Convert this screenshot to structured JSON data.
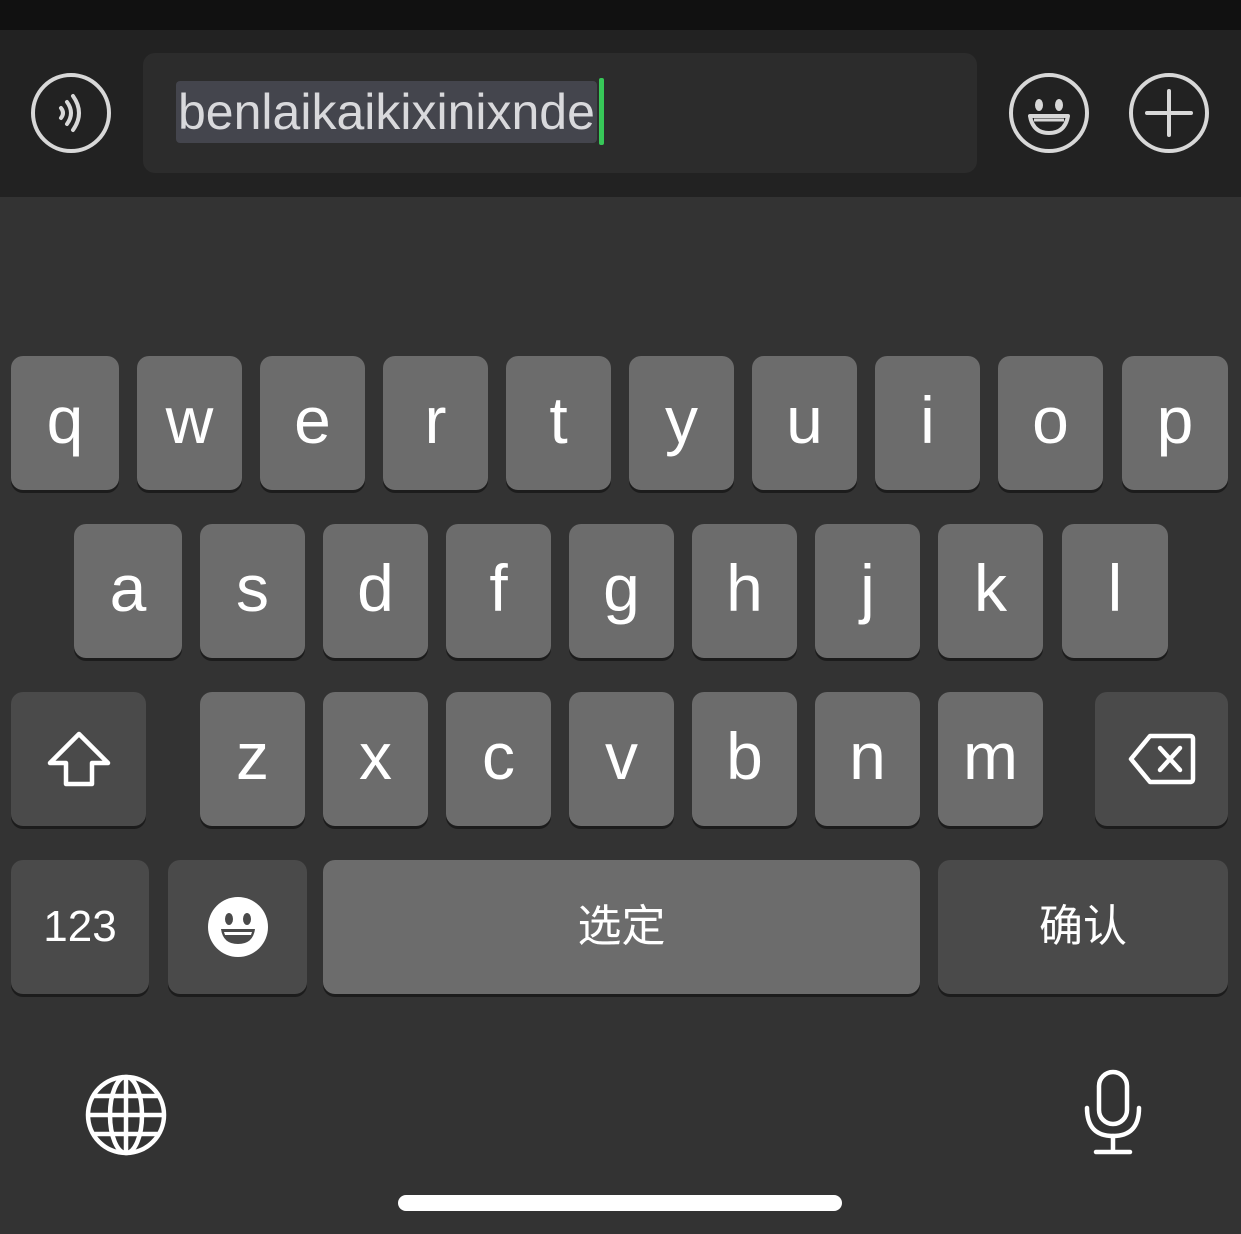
{
  "input_bar": {
    "typed_text": "benlaikaikixinixnde",
    "caret_color": "#37c758",
    "left_icon": "voice-message-icon",
    "right_icons": [
      "emoji-icon",
      "add-icon"
    ]
  },
  "keyboard": {
    "row1": [
      "q",
      "w",
      "e",
      "r",
      "t",
      "y",
      "u",
      "i",
      "o",
      "p"
    ],
    "row2": [
      "a",
      "s",
      "d",
      "f",
      "g",
      "h",
      "j",
      "k",
      "l"
    ],
    "row3": [
      "z",
      "x",
      "c",
      "v",
      "b",
      "n",
      "m"
    ],
    "shift_icon": "shift-icon",
    "delete_icon": "backspace-icon",
    "numbers_label": "123",
    "emoji_key_icon": "emoji-icon",
    "space_label": "选定",
    "confirm_label": "确认",
    "globe_icon": "globe-icon",
    "mic_icon": "microphone-icon"
  }
}
